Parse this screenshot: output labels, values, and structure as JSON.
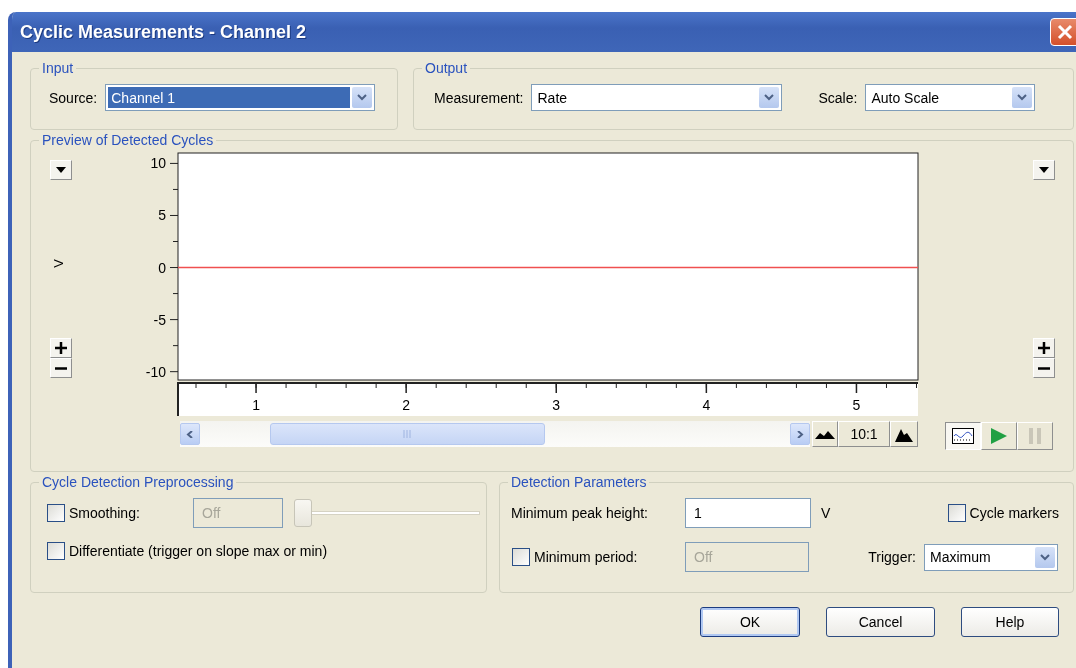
{
  "window": {
    "title": "Cyclic Measurements - Channel 2"
  },
  "input": {
    "legend": "Input",
    "source": {
      "label": "Source:",
      "value": "Channel 1",
      "focused": true
    }
  },
  "output": {
    "legend": "Output",
    "measurement": {
      "label": "Measurement:",
      "value": "Rate",
      "focused": false
    },
    "scale": {
      "label": "Scale:",
      "value": "Auto Scale",
      "focused": false
    }
  },
  "preview": {
    "legend": "Preview of Detected Cycles",
    "y_unit": "V",
    "zoom_ratio": "10:1",
    "chart_data": {
      "type": "line",
      "x": [
        0.48,
        5.41
      ],
      "series": [
        {
          "color": "#f05050",
          "values": [
            0,
            0
          ]
        }
      ],
      "xlim": [
        0.48,
        5.41
      ],
      "ylim": [
        -10.8,
        11
      ],
      "xticks": [
        1,
        2,
        3,
        4,
        5
      ],
      "yticks": [
        -10,
        -5,
        0,
        5,
        10
      ]
    },
    "toolbar": [
      {
        "kind": "chart",
        "pressed": true,
        "disabled": false
      },
      {
        "kind": "play",
        "pressed": false,
        "disabled": false
      },
      {
        "kind": "pause",
        "pressed": false,
        "disabled": true
      }
    ]
  },
  "preprocessing": {
    "legend": "Cycle Detection Preprocessing",
    "smoothing": {
      "label": "Smoothing:",
      "checked": false,
      "value": "Off",
      "disabled": true,
      "level": 0
    },
    "differentiate": {
      "label": "Differentiate (trigger on slope max or min)",
      "checked": false
    }
  },
  "detection": {
    "legend": "Detection Parameters",
    "min_peak_height": {
      "label": "Minimum peak height:",
      "value": "1",
      "unit": "V"
    },
    "cycle_markers": {
      "label": "Cycle markers",
      "checked": false
    },
    "min_period": {
      "label": "Minimum period:",
      "checked": false,
      "value": "Off",
      "disabled": true
    },
    "trigger": {
      "label": "Trigger:",
      "value": "Maximum",
      "focused": false
    }
  },
  "buttons": [
    {
      "label": "OK",
      "default": true
    },
    {
      "label": "Cancel",
      "default": false
    },
    {
      "label": "Help",
      "default": false
    }
  ]
}
